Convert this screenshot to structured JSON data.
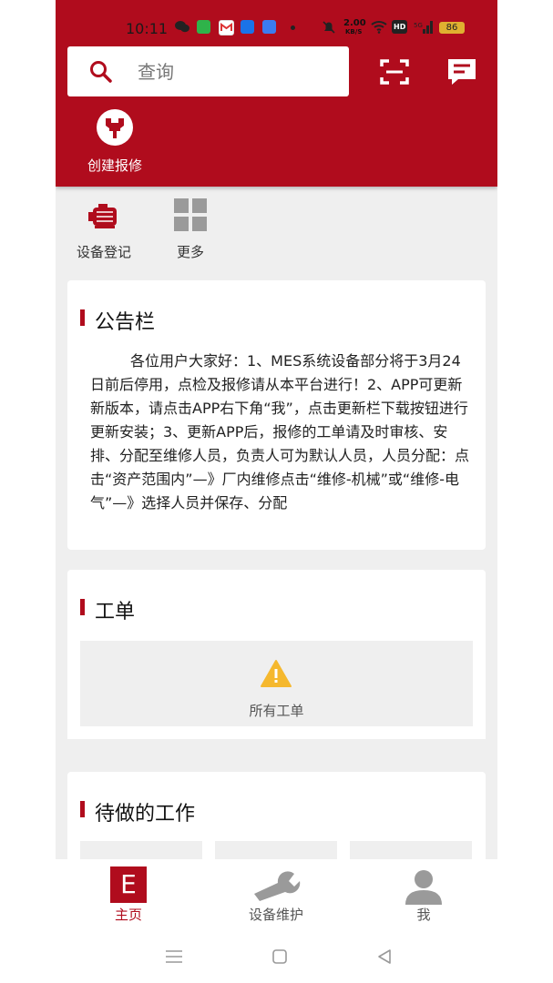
{
  "status_bar": {
    "time": "10:11",
    "speed_value": "2.00",
    "speed_unit": "KB/S",
    "hd_label": "HD",
    "battery": "86"
  },
  "header": {
    "search_placeholder": "查询",
    "create_repair_label": "创建报修"
  },
  "quick_actions": [
    {
      "label": "设备登记",
      "icon": "motor-icon"
    },
    {
      "label": "更多",
      "icon": "grid-icon"
    }
  ],
  "notice": {
    "title": "公告栏",
    "text": "各位用户大家好：1、MES系统设备部分将于3月24日前后停用，点检及报修请从本平台进行！2、APP可更新新版本，请点击APP右下角“我”，点击更新栏下载按钮进行更新安装；3、更新APP后，报修的工单请及时审核、安排、分配至维修人员，负责人可为默认人员，人员分配：点击“资产范围内”—》厂内维修点击“维修-机械”或“维修-电气”—》选择人员并保存、分配"
  },
  "work_order": {
    "title": "工单",
    "empty_label": "所有工单"
  },
  "todo": {
    "title": "待做的工作"
  },
  "bottom_tabs": [
    {
      "label": "主页",
      "active": true,
      "icon_letter": "E"
    },
    {
      "label": "设备维护",
      "active": false
    },
    {
      "label": "我",
      "active": false
    }
  ],
  "colors": {
    "brand": "#b00c1d",
    "warning": "#f5b82e",
    "icon_grey": "#9a9a9a"
  }
}
